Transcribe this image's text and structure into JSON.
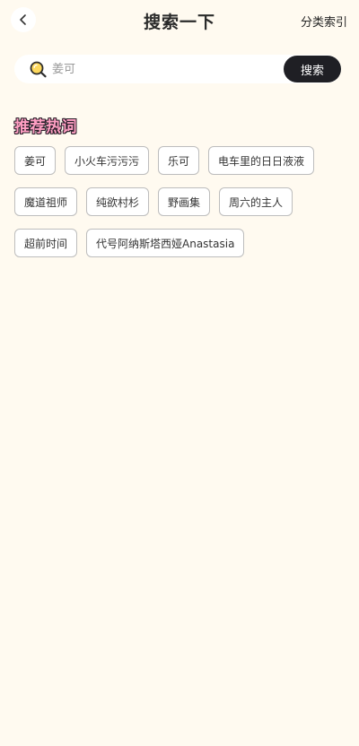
{
  "header": {
    "title": "搜索一下",
    "category_link": "分类索引"
  },
  "search": {
    "placeholder": "姜可",
    "button_label": "搜索"
  },
  "hot": {
    "title": "推荐热词",
    "tags": [
      "姜可",
      "小火车污污污",
      "乐可",
      "电车里的日日液液",
      "魔道祖师",
      "纯欲村杉",
      "野画集",
      "周六的主人",
      "超前时间",
      "代号阿纳斯塔西娅Anastasia"
    ]
  },
  "colors": {
    "background": "#fffaf0",
    "search_button": "#1f1f24",
    "section_title_fill": "#ff9fc3"
  }
}
